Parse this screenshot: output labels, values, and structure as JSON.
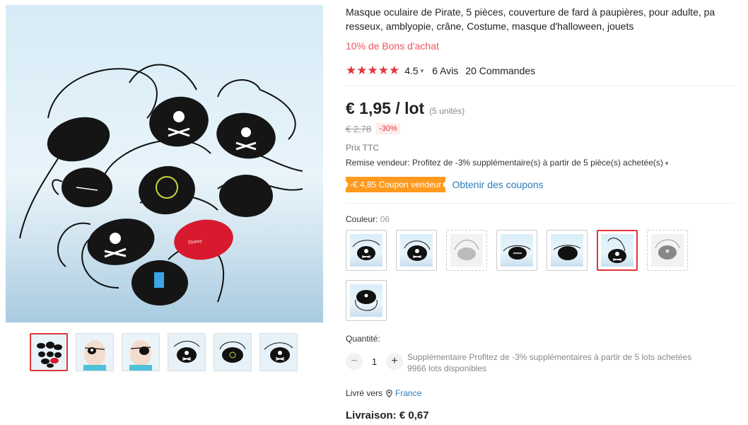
{
  "product": {
    "title": "Masque oculaire de Pirate, 5 pièces, couverture de fard à paupières, pour adulte, pa resseux, amblyopie, crâne, Costume, masque d'halloween, jouets",
    "promo": "10% de Bons d'achat",
    "rating_value": "4.5",
    "stars": "★★★★★",
    "reviews": "6 Avis",
    "orders": "20 Commandes"
  },
  "price": {
    "current": "€ 1,95 / lot",
    "units": "(5 unités)",
    "original": "€ 2,78",
    "discount": "-30%",
    "tax_note": "Prix TTC",
    "seller_discount": "Remise vendeur: Profitez de -3% supplémentaire(s) à partir de 5 pièce(s) achetée(s)",
    "coupon_badge": "-€ 4,85 Coupon vendeur",
    "coupon_link": "Obtenir des coupons"
  },
  "color": {
    "label": "Couleur: ",
    "selected": "06",
    "selected_index": 5
  },
  "quantity": {
    "label": "Quantité:",
    "minus": "−",
    "value": "1",
    "plus": "+",
    "extra": "Supplémentaire Profitez de -3% supplémentaires à partir de 5 lots achetées",
    "available": "9966 lots disponibles"
  },
  "shipping": {
    "label": "Livré vers",
    "country": "France",
    "delivery": "Livraison: € 0,67"
  },
  "colors": {
    "accent": "#e0353b",
    "coupon": "#ff9a1e",
    "link": "#2e7bb8",
    "promo": "#f0565b"
  }
}
